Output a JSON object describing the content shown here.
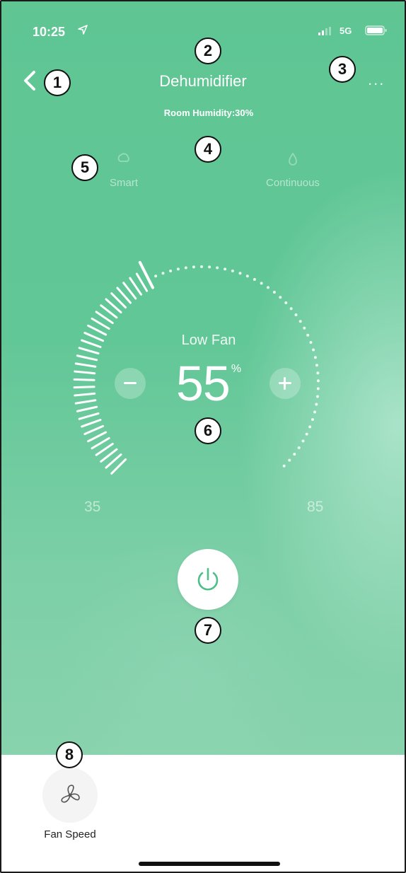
{
  "status_bar": {
    "time": "10:25",
    "network": "5G"
  },
  "header": {
    "title": "Dehumidifier",
    "more": "...",
    "room_humidity": "Room Humidity:30%"
  },
  "modes": [
    {
      "label": "Smart",
      "icon": "smart-mode-icon"
    },
    {
      "label": "Continuous",
      "icon": "continuous-mode-icon"
    }
  ],
  "dial": {
    "fan_label": "Low Fan",
    "value": "55",
    "unit": "%",
    "min": "35",
    "max": "85",
    "value_fraction": 0.4
  },
  "bottom_bar": {
    "fan_speed_label": "Fan Speed"
  },
  "callouts": [
    "1",
    "2",
    "3",
    "4",
    "5",
    "6",
    "7",
    "8"
  ],
  "colors": {
    "accent_green": "#5ec593",
    "power_icon": "#4cbf8a"
  }
}
